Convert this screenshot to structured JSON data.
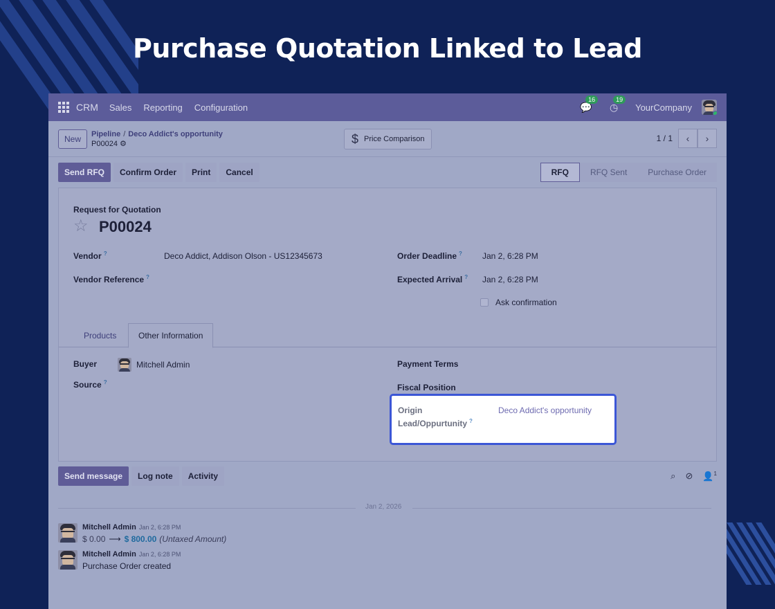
{
  "hero": {
    "title": "Purchase Quotation Linked to Lead"
  },
  "topbar": {
    "brand": "CRM",
    "menu": [
      "Sales",
      "Reporting",
      "Configuration"
    ],
    "messages_count": "16",
    "activities_count": "19",
    "company": "YourCompany"
  },
  "control": {
    "new_label": "New",
    "breadcrumb_parent": "Pipeline",
    "breadcrumb_opportunity": "Deco Addict's opportunity",
    "breadcrumb_current": "P00024",
    "price_comparison": "Price Comparison",
    "pager": "1 / 1"
  },
  "actions": {
    "buttons": [
      "Send RFQ",
      "Confirm Order",
      "Print",
      "Cancel"
    ],
    "stages": [
      "RFQ",
      "RFQ Sent",
      "Purchase Order"
    ]
  },
  "form": {
    "doc_type": "Request for Quotation",
    "doc_number": "P00024",
    "vendor_label": "Vendor",
    "vendor_value": "Deco Addict, Addison Olson - US12345673",
    "vendor_ref_label": "Vendor Reference",
    "deadline_label": "Order Deadline",
    "deadline_value": "Jan 2, 6:28 PM",
    "arrival_label": "Expected Arrival",
    "arrival_value": "Jan 2, 6:28 PM",
    "ask_confirmation": "Ask confirmation",
    "tabs": [
      "Products",
      "Other Information"
    ],
    "buyer_label": "Buyer",
    "buyer_value": "Mitchell Admin",
    "source_label": "Source",
    "payment_terms_label": "Payment Terms",
    "fiscal_position_label": "Fiscal Position",
    "origin_label": "Origin",
    "origin_value": "Deco Addict's opportunity",
    "lead_label": "Lead/Oppurtunity"
  },
  "chatter": {
    "buttons": [
      "Send message",
      "Log note",
      "Activity"
    ],
    "followers_count": "1",
    "date": "Jan 2, 2026",
    "messages": [
      {
        "author": "Mitchell Admin",
        "time": "Jan 2, 6:28 PM",
        "old": "$ 0.00",
        "arrow": "⟶",
        "new": "$ 800.00",
        "note": "(Untaxed Amount)"
      },
      {
        "author": "Mitchell Admin",
        "time": "Jan 2, 6:28 PM",
        "text": "Purchase Order created"
      }
    ]
  },
  "colors": {
    "background": "#0f2257",
    "highlight_border": "#3b56d6",
    "navbar": "#5c5c9a"
  }
}
